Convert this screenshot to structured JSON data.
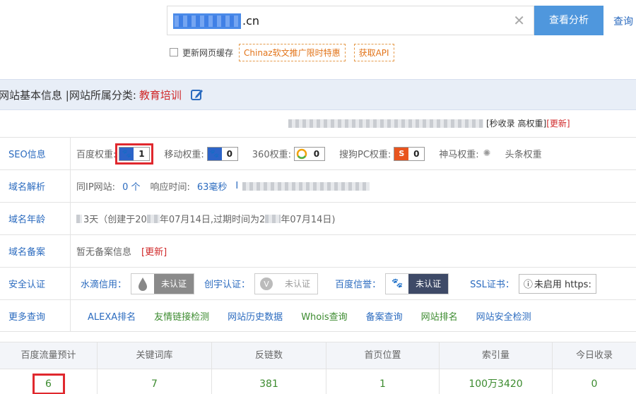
{
  "search": {
    "value": ".cn",
    "button": "查看分析",
    "query_link": "查询"
  },
  "cache": {
    "label": "更新网页缓存",
    "promo": "Chinaz软文推广限时特惠",
    "api": "获取API"
  },
  "title": {
    "basic": "网站基本信息  |网站所属分类:",
    "category": "教育培训"
  },
  "sub_note": {
    "text": "[秒收录 高权重]",
    "update": "[更新]"
  },
  "rows": {
    "seo": {
      "label": "SEO信息",
      "baidu": "百度权重:",
      "baidu_val": "1",
      "mobile": "移动权重:",
      "mobile_val": "0",
      "w360": "360权重:",
      "w360_val": "0",
      "sogou": "搜狗PC权重:",
      "sogou_val": "0",
      "shenma": "神马权重:",
      "toutiao": "头条权重"
    },
    "dns": {
      "label": "域名解析",
      "same_ip": "同IP网站:",
      "same_ip_val": "0 个",
      "resp": "响应时间:",
      "resp_val": "63毫秒",
      "ip_prefix": "I"
    },
    "age": {
      "label": "域名年龄",
      "text": "3天（创建于20",
      "text2": "年07月14日,过期时间为2",
      "text3": "年07月14日)"
    },
    "icp": {
      "label": "域名备案",
      "text": "暂无备案信息",
      "update": "[更新]"
    },
    "security": {
      "label": "安全认证",
      "shuidi": "水滴信用：",
      "shuidi_badge": "未认证",
      "chuangzi": "创宇认证：",
      "chuangzi_badge": "未认证",
      "baidu": "百度信誉：",
      "baidu_badge": "未认证",
      "ssl": "SSL证书：",
      "ssl_val": "未启用 https:"
    },
    "more": {
      "label": "更多查询",
      "links": [
        "ALEXA排名",
        "友情链接检测",
        "网站历史数据",
        "Whois查询",
        "备案查询",
        "网站排名",
        "网站安全检测"
      ]
    }
  },
  "stats": {
    "headers": [
      "百度流量预计",
      "关键词库",
      "反链数",
      "首页位置",
      "索引量",
      "今日收录"
    ],
    "values": [
      "6",
      "7",
      "381",
      "1",
      "100万3420",
      "0"
    ]
  },
  "colors": {
    "accent": "#4f97dd",
    "link": "#2b6bbf",
    "red": "#d0292a",
    "green": "#3c8b2f",
    "highlight": "#e0282e"
  }
}
